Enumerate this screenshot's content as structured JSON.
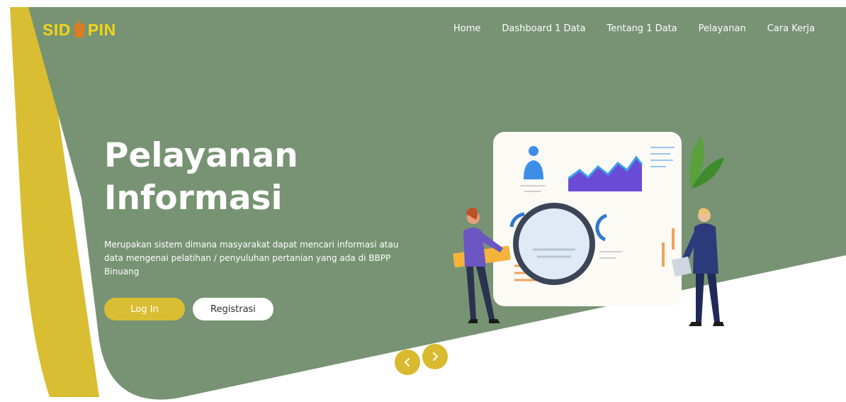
{
  "brand": {
    "logo_left": "SID",
    "logo_right": "PIN"
  },
  "nav": {
    "items": [
      {
        "label": "Home"
      },
      {
        "label": "Dashboard 1 Data"
      },
      {
        "label": "Tentang 1 Data"
      },
      {
        "label": "Pelayanan"
      },
      {
        "label": "Cara Kerja"
      }
    ]
  },
  "hero": {
    "title_line1": "Pelayanan",
    "title_line2": "Informasi",
    "description": "Merupakan sistem dimana masyarakat dapat mencari informasi atau data mengenai pelatihan / penyuluhan pertanian yang ada di BBPP Binuang",
    "login_label": "Log In",
    "register_label": "Registrasi"
  },
  "carousel": {
    "prev_icon": "chevron-left-icon",
    "next_icon": "chevron-right-icon"
  },
  "colors": {
    "green": "#779373",
    "yellow": "#d9bd32",
    "logo_yellow": "#f2d516",
    "white": "#ffffff"
  },
  "illustration": {
    "name": "data-analysis-illustration"
  }
}
